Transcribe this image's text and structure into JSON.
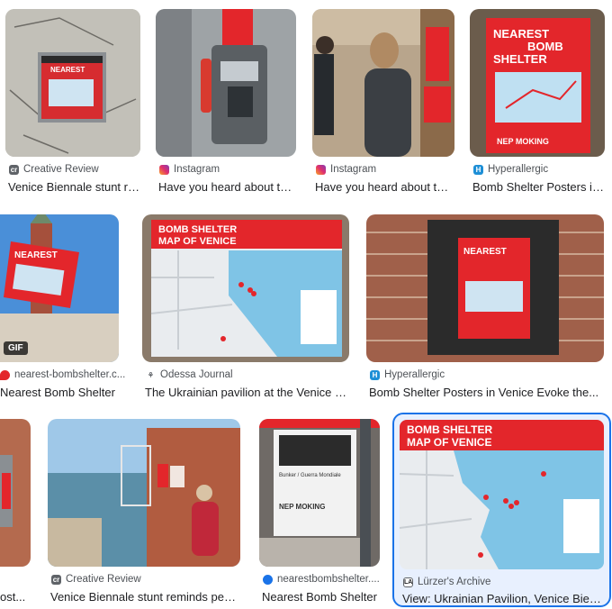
{
  "results": [
    {
      "source": "Creative Review",
      "title": "Venice Biennale stunt reminds people...",
      "favicon": "cr-icon"
    },
    {
      "source": "Instagram",
      "title": "Have you heard about this project...",
      "favicon": "instagram-icon"
    },
    {
      "source": "Instagram",
      "title": "Have you heard about this project...",
      "favicon": "instagram-icon"
    },
    {
      "source": "Hyperallergic",
      "title": "Bomb Shelter Posters in Venice Evoke the...",
      "favicon": "hyperallergic-icon"
    },
    {
      "source": "nearest-bombshelter.c...",
      "title": "Nearest Bomb Shelter",
      "favicon": "pin-icon",
      "badge": "GIF"
    },
    {
      "source": "Odessa Journal",
      "title": "The Ukrainian pavilion at the Venice Biennale",
      "favicon": "odessa-icon"
    },
    {
      "source": "Hyperallergic",
      "title": "Bomb Shelter Posters in Venice Evoke the...",
      "favicon": "hyperallergic-icon"
    },
    {
      "source": "",
      "title": "ost...",
      "favicon": ""
    },
    {
      "source": "Creative Review",
      "title": "Venice Biennale stunt reminds people...",
      "favicon": "cr-icon"
    },
    {
      "source": "nearestbombshelter....",
      "title": "Nearest Bomb Shelter",
      "favicon": "globe-icon"
    },
    {
      "source": "Lürzer's Archive",
      "title": "View: Ukrainian Pavilion, Venice Biennale",
      "favicon": "la-icon"
    }
  ],
  "posters": {
    "nearest_line1": "NEAREST",
    "nearest_line2": "BOMB",
    "nearest_line3": "SHELTER",
    "map_title_1": "BOMB SHELTER",
    "map_title_2": "MAP OF VENICE",
    "brand": "NEP MOKING",
    "map_sub": "Bunker / Guerra Mondiale"
  },
  "colors": {
    "poster_red": "#e3262b",
    "selected": "#1a73e8",
    "sea": "#7fc4e6",
    "land": "#e9ecef"
  }
}
